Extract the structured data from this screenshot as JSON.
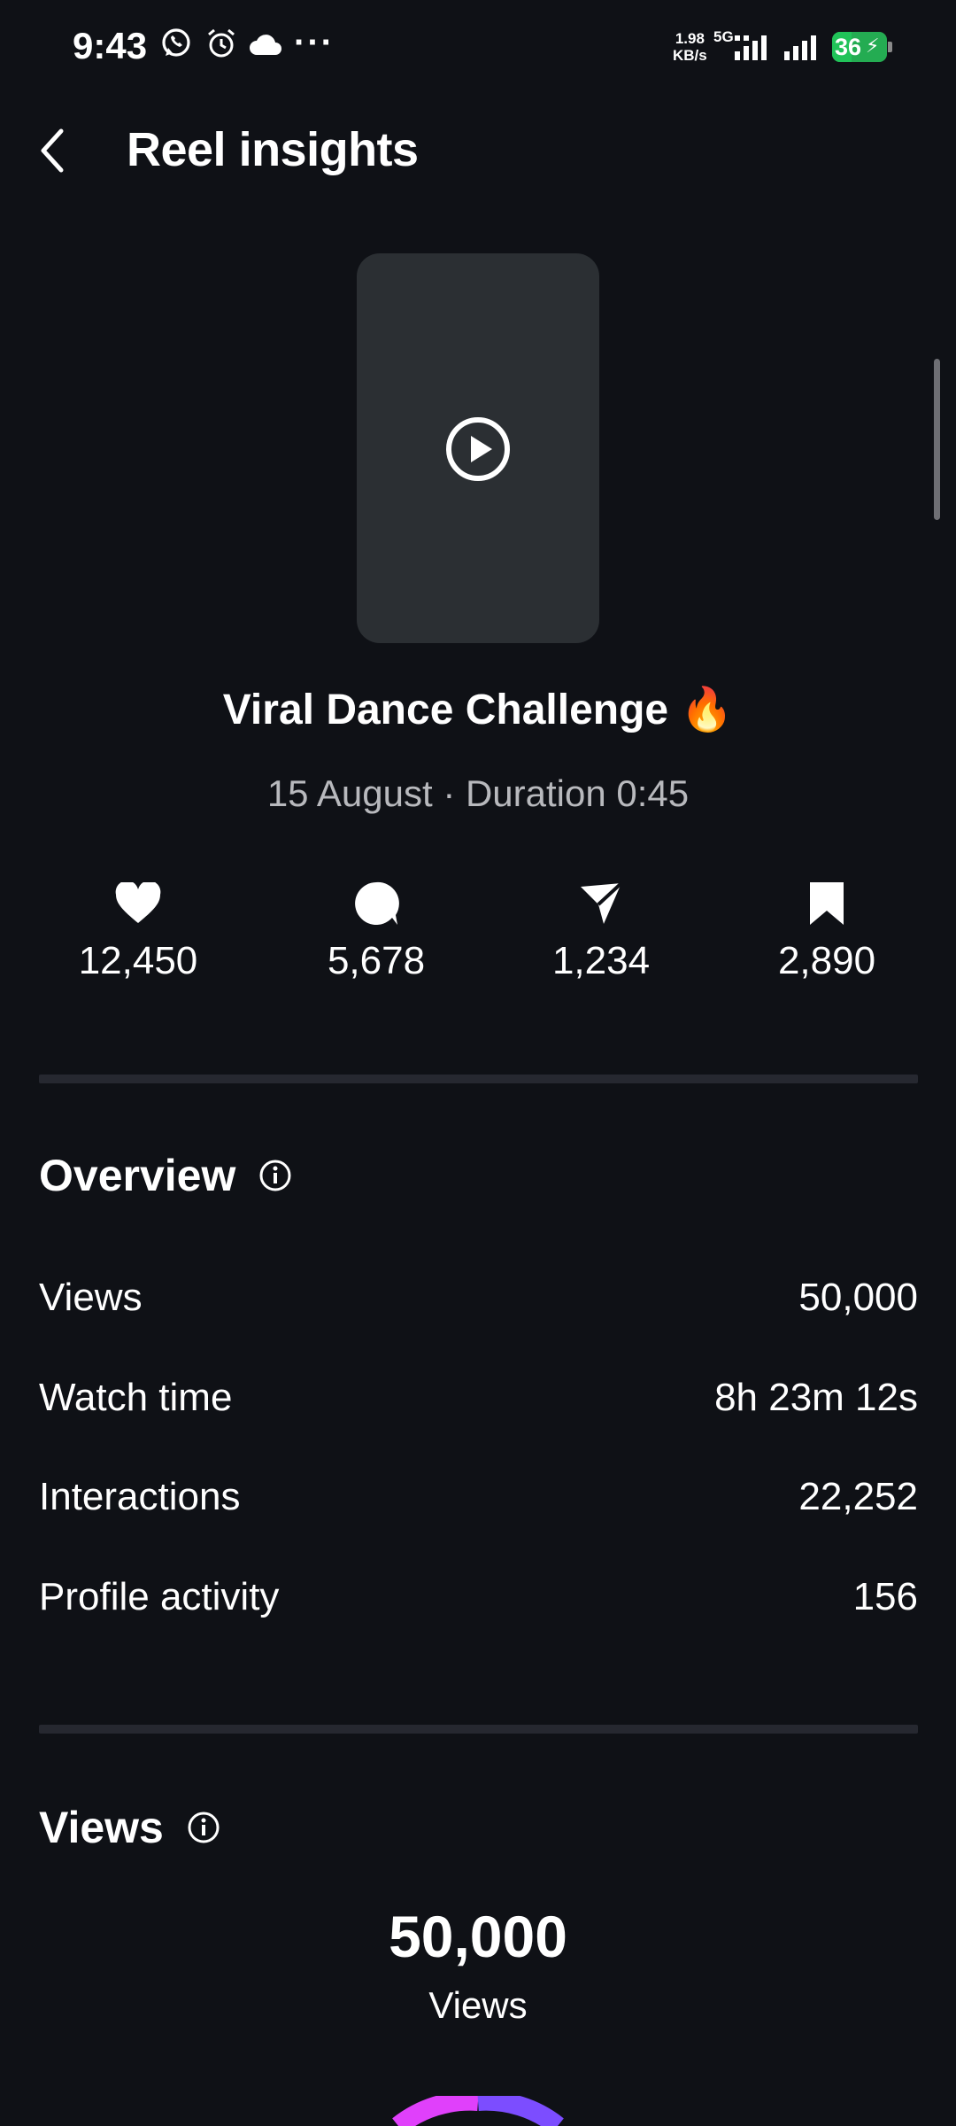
{
  "status_bar": {
    "time": "9:43",
    "net_speed_value": "1.98",
    "net_speed_unit": "KB/s",
    "network_type": "5G",
    "battery_level": "36",
    "icons": [
      "whatsapp-icon",
      "alarm-icon",
      "cloud-icon",
      "more-dots-icon",
      "signal-icon",
      "signal-icon",
      "battery-charging-icon"
    ]
  },
  "header": {
    "title": "Reel insights",
    "back_icon": "chevron-left-icon"
  },
  "reel": {
    "title": "Viral Dance Challenge 🔥",
    "meta": "15 August · Duration 0:45"
  },
  "stats": {
    "likes": "12,450",
    "comments": "5,678",
    "shares": "1,234",
    "saves": "2,890"
  },
  "overview": {
    "title": "Overview",
    "rows": [
      {
        "label": "Views",
        "value": "50,000"
      },
      {
        "label": "Watch time",
        "value": "8h 23m 12s"
      },
      {
        "label": "Interactions",
        "value": "22,252"
      },
      {
        "label": "Profile activity",
        "value": "156"
      }
    ]
  },
  "views_section": {
    "title": "Views",
    "total": "50,000",
    "total_label": "Views"
  },
  "colors": {
    "background": "#0f1116",
    "divider": "#262830",
    "secondary_text": "#b8b9bd",
    "thumbnail": "#2b2f33",
    "battery": "#22c35a",
    "donut_pink": "#e040fb",
    "donut_purple": "#7c4dff"
  }
}
